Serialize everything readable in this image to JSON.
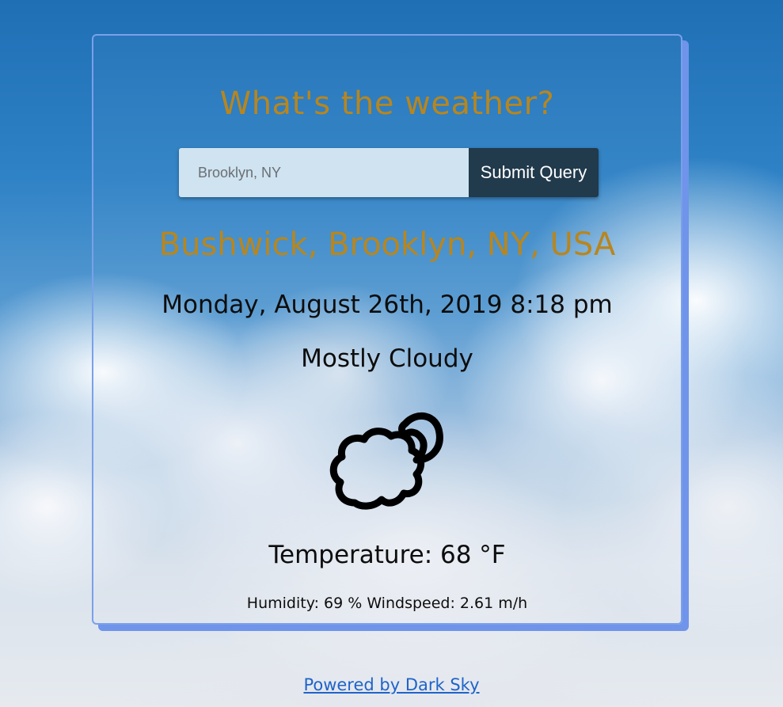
{
  "header": {
    "title": "What's the weather?"
  },
  "search": {
    "placeholder": "Brooklyn, NY",
    "value": "",
    "submit_label": "Submit Query"
  },
  "result": {
    "location": "Bushwick, Brooklyn, NY, USA",
    "datetime": "Monday, August 26th, 2019 8:18 pm",
    "summary": "Mostly Cloudy",
    "icon": "partly-cloudy-night-icon",
    "temperature": "Temperature: 68 °F",
    "details": "Humidity: 69 % Windspeed: 2.61 m/h"
  },
  "footer": {
    "link_text": "Powered by Dark Sky"
  },
  "colors": {
    "heading": "#b8861e",
    "card_border": "#7aa0ea",
    "input_bg": "#cfe3f0",
    "button_bg": "#213a4c",
    "link": "#1f63c9"
  }
}
